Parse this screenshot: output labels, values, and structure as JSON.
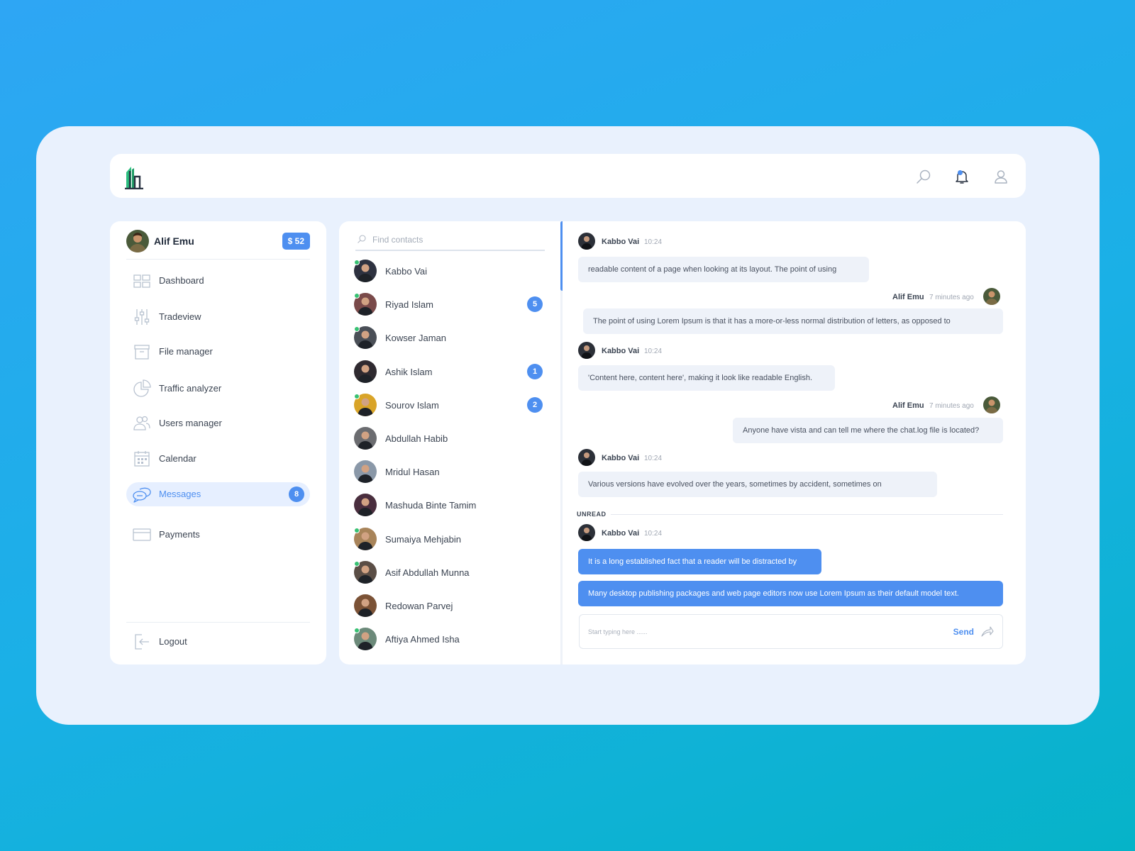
{
  "colors": {
    "accent": "#4e8ff0",
    "online": "#37c172",
    "logo_green": "#2bbd7e",
    "logo_dark": "#2a3342"
  },
  "icons": {
    "logo": "building-logo",
    "search": "search-icon",
    "notifications": "bell-icon",
    "profile": "user-icon"
  },
  "user": {
    "name": "Alif Emu",
    "balance": "$ 52"
  },
  "sidebar": {
    "items": [
      {
        "label": "Dashboard",
        "icon": "dashboard-icon"
      },
      {
        "label": "Tradeview",
        "icon": "sliders-icon"
      },
      {
        "label": "File manager",
        "icon": "archive-icon"
      },
      {
        "label": "Traffic analyzer",
        "icon": "pie-chart-icon"
      },
      {
        "label": "Users manager",
        "icon": "users-icon"
      },
      {
        "label": "Calendar",
        "icon": "calendar-icon"
      },
      {
        "label": "Messages",
        "icon": "chat-icon",
        "active": true,
        "badge": "8"
      },
      {
        "label": "Payments",
        "icon": "credit-card-icon"
      }
    ],
    "logout": "Logout"
  },
  "contacts": {
    "search_placeholder": "Find contacts",
    "list": [
      {
        "name": "Kabbo Vai",
        "online": true,
        "badge": ""
      },
      {
        "name": "Riyad Islam",
        "online": true,
        "badge": "5"
      },
      {
        "name": "Kowser Jaman",
        "online": true,
        "badge": ""
      },
      {
        "name": "Ashik Islam",
        "online": false,
        "badge": "1"
      },
      {
        "name": "Sourov Islam",
        "online": true,
        "badge": "2"
      },
      {
        "name": "Abdullah Habib",
        "online": false,
        "badge": ""
      },
      {
        "name": "Mridul Hasan",
        "online": false,
        "badge": ""
      },
      {
        "name": "Mashuda Binte Tamim",
        "online": false,
        "badge": ""
      },
      {
        "name": "Sumaiya Mehjabin",
        "online": true,
        "badge": ""
      },
      {
        "name": "Asif Abdullah Munna",
        "online": true,
        "badge": ""
      },
      {
        "name": "Redowan Parvej",
        "online": false,
        "badge": ""
      },
      {
        "name": "Aftiya Ahmed Isha",
        "online": true,
        "badge": ""
      }
    ]
  },
  "chat": {
    "messages": [
      {
        "sender": "Kabbo Vai",
        "time": "10:24",
        "text": "readable content of a page when looking at its layout. The point of using",
        "mine": false
      },
      {
        "sender": "Alif Emu",
        "time": "7 minutes ago",
        "text": "The point of using Lorem Ipsum is that it has a more-or-less normal distribution of letters, as opposed to",
        "mine": true
      },
      {
        "sender": "Kabbo Vai",
        "time": "10:24",
        "text": "'Content here, content here', making it look like readable English.",
        "mine": false
      },
      {
        "sender": "Alif Emu",
        "time": "7 minutes ago",
        "text": "Anyone have vista and can tell me where the chat.log file is located?",
        "mine": true
      },
      {
        "sender": "Kabbo Vai",
        "time": "10:24",
        "text": "Various versions have evolved over the years, sometimes by accident, sometimes on",
        "mine": false
      }
    ],
    "unread_label": "UNREAD",
    "unread": {
      "sender": "Kabbo Vai",
      "time": "10:24",
      "texts": [
        "It is a long established fact that a reader will be distracted by",
        "Many desktop publishing packages and web page editors now use Lorem Ipsum as their default model text."
      ]
    },
    "composer_placeholder": "Start typing here ......",
    "send_label": "Send"
  }
}
